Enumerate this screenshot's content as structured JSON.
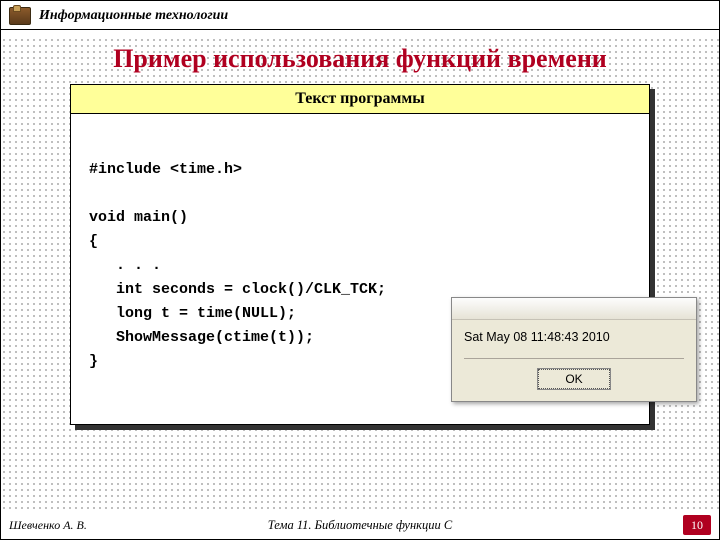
{
  "header": {
    "course_title": "Информационные технологии"
  },
  "main": {
    "title": "Пример использования функций времени",
    "code_header": "Текст программы",
    "code_body": "\n#include <time.h>\n\nvoid main()\n{\n   . . .\n   int seconds = clock()/CLK_TCK;\n   long t = time(NULL);\n   ShowMessage(ctime(t));\n}"
  },
  "dialog": {
    "timestamp": "Sat May 08 11:48:43 2010",
    "ok_label": "OK"
  },
  "footer": {
    "author": "Шевченко А. В.",
    "topic": "Тема 11. Библиотечные функции С",
    "page": "10"
  }
}
